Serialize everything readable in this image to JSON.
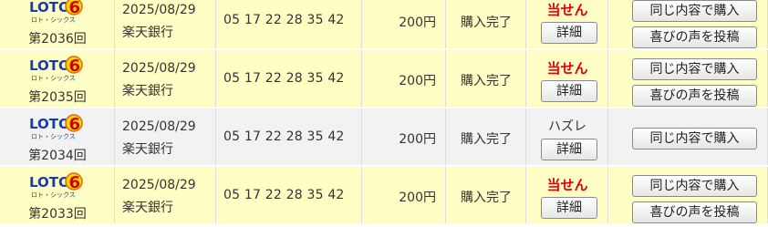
{
  "rows": [
    {
      "kind": "win",
      "round": "第2036回",
      "date": "2025/08/29",
      "bank": "楽天銀行",
      "numbers": "05 17 22 28 35 42",
      "price": "200円",
      "status": "購入完了",
      "result": "当せん",
      "detail_label": "詳細",
      "buy_label": "同じ内容で購入",
      "post_label": "喜びの声を投稿"
    },
    {
      "kind": "win",
      "round": "第2035回",
      "date": "2025/08/29",
      "bank": "楽天銀行",
      "numbers": "05 17 22 28 35 42",
      "price": "200円",
      "status": "購入完了",
      "result": "当せん",
      "detail_label": "詳細",
      "buy_label": "同じ内容で購入",
      "post_label": "喜びの声を投稿"
    },
    {
      "kind": "lose",
      "round": "第2034回",
      "date": "2025/08/29",
      "bank": "楽天銀行",
      "numbers": "05 17 22 28 35 42",
      "price": "200円",
      "status": "購入完了",
      "result": "ハズレ",
      "detail_label": "詳細",
      "buy_label": "同じ内容で購入",
      "post_label": ""
    },
    {
      "kind": "win",
      "round": "第2033回",
      "date": "2025/08/29",
      "bank": "楽天銀行",
      "numbers": "05 17 22 28 35 42",
      "price": "200円",
      "status": "購入完了",
      "result": "当せん",
      "detail_label": "詳細",
      "buy_label": "同じ内容で購入",
      "post_label": "喜びの声を投稿"
    }
  ],
  "logo": {
    "text": "LOTO",
    "digit": "6",
    "kana": "ロト・シックス",
    "colors": {
      "brand_blue": "#1a3fa0",
      "digit_orange": "#f07800",
      "digit_red": "#d40000"
    }
  },
  "colors": {
    "win_row_bg": "#fffec4",
    "lose_row_bg": "#f2f2f2",
    "win_text": "#e60012"
  }
}
